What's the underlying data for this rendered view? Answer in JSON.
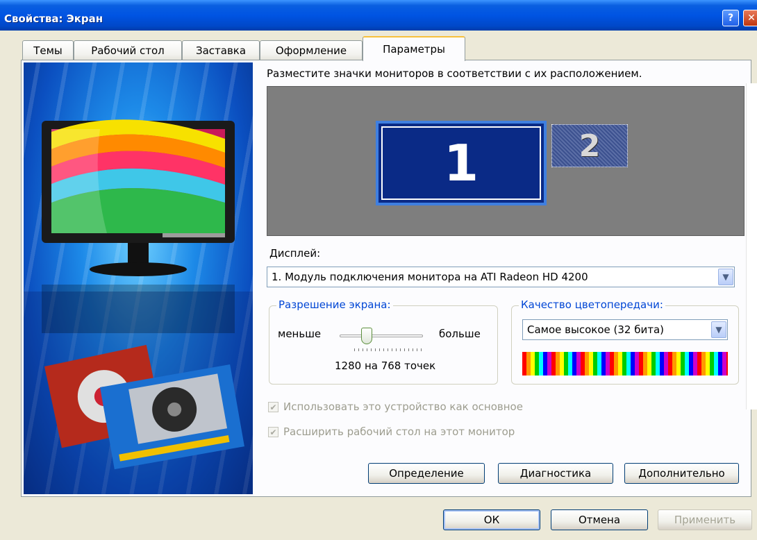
{
  "window": {
    "title": "Свойства: Экран"
  },
  "tabs": [
    {
      "label": "Темы"
    },
    {
      "label": "Рабочий стол"
    },
    {
      "label": "Заставка"
    },
    {
      "label": "Оформление"
    },
    {
      "label": "Параметры",
      "active": true
    }
  ],
  "settings": {
    "instruction": "Разместите значки мониторов в соответствии с их расположением.",
    "monitors": [
      {
        "number": "1",
        "selected": true
      },
      {
        "number": "2",
        "selected": false
      }
    ],
    "display_label": "Дисплей:",
    "display_value": "1. Модуль подключения монитора на ATI Radeon HD 4200",
    "resolution": {
      "title": "Разрешение экрана:",
      "less": "меньше",
      "more": "больше",
      "value_text": "1280 на 768 точек"
    },
    "color_quality": {
      "title": "Качество цветопередачи:",
      "value": "Самое высокое (32 бита)"
    },
    "checkboxes": [
      {
        "label": "Использовать это устройство как основное",
        "checked": true,
        "enabled": false
      },
      {
        "label": "Расширить рабочий стол на этот монитор",
        "checked": true,
        "enabled": false
      }
    ],
    "buttons": {
      "identify": "Определение",
      "troubleshoot": "Диагностика",
      "advanced": "Дополнительно"
    }
  },
  "dialog_buttons": {
    "ok": "ОК",
    "cancel": "Отмена",
    "apply": "Применить"
  },
  "icons": {
    "help": "help-icon",
    "close": "close-icon",
    "dropdown": "chevron-down-icon",
    "check": "check-icon"
  },
  "colors": {
    "titlebar": "#0054e3",
    "monitor_selected": "#0a2a86",
    "group_title": "#0046d5"
  }
}
